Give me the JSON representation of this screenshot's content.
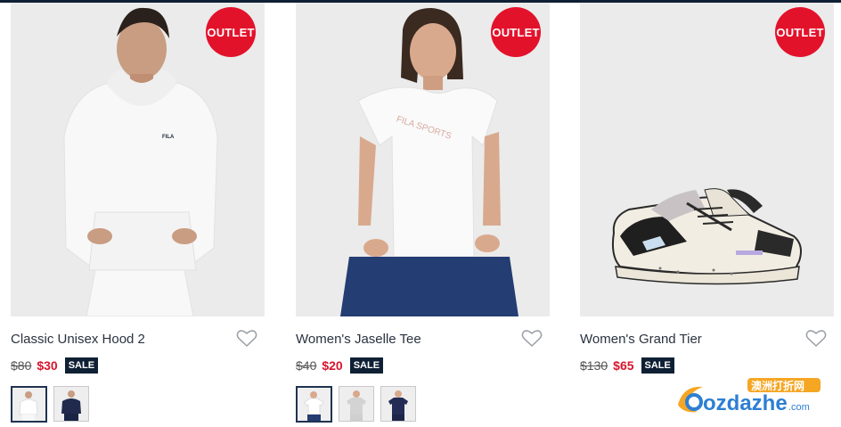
{
  "products": [
    {
      "title": "Classic Unisex Hood 2",
      "badge": "OUTLET",
      "old_price": "$80",
      "new_price": "$30",
      "sale_label": "SALE",
      "swatches": [
        "white",
        "navy"
      ]
    },
    {
      "title": "Women's Jaselle Tee",
      "badge": "OUTLET",
      "old_price": "$40",
      "new_price": "$20",
      "sale_label": "SALE",
      "swatches": [
        "white",
        "grey",
        "navy"
      ]
    },
    {
      "title": "Women's Grand Tier",
      "badge": "OUTLET",
      "old_price": "$130",
      "new_price": "$65",
      "sale_label": "SALE",
      "swatches": []
    }
  ],
  "watermark": {
    "brand": "ozdazhe",
    "suffix": ".com",
    "tag": "澳洲打折网"
  },
  "colors": {
    "outlet_badge": "#e3122b",
    "sale_badge": "#0f2035",
    "sale_price": "#d7152c",
    "card_bg": "#ebebeb"
  }
}
